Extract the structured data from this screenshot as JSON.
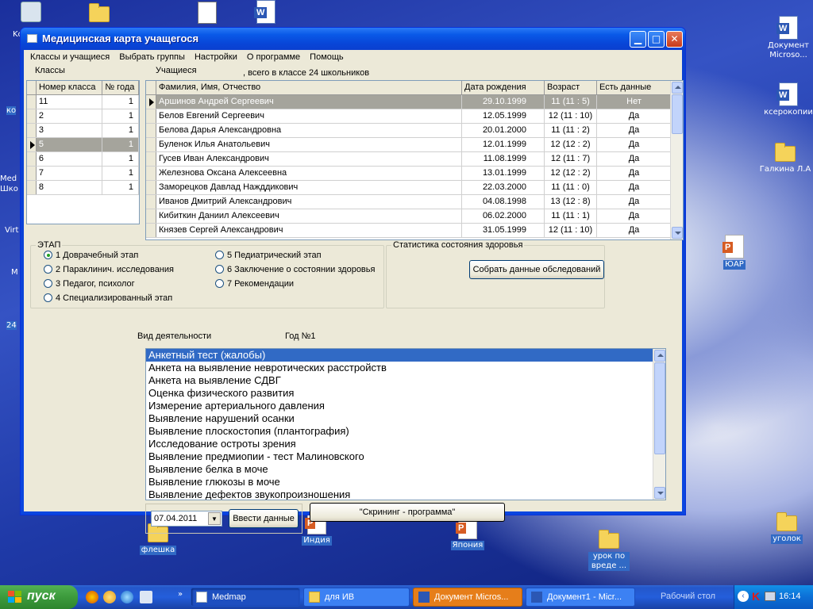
{
  "desktop": {
    "icons": [
      {
        "label": "Документ Microso...",
        "kind": "word"
      },
      {
        "label": "ксерокопии",
        "kind": "word"
      },
      {
        "label": "Галкина Л.А",
        "kind": "folder"
      },
      {
        "label": "ЮАР",
        "kind": "ppt"
      },
      {
        "label": "уголок",
        "kind": "folder"
      },
      {
        "label": "урок по вреде ...",
        "kind": "folder"
      },
      {
        "label": "Япония",
        "kind": "ppt"
      },
      {
        "label": "Индия",
        "kind": "ppt"
      },
      {
        "label": "флешка",
        "kind": "folder"
      }
    ],
    "edge_labels": [
      "Kc",
      "ко",
      "Med",
      "Шко",
      "Virt",
      "M",
      "24"
    ]
  },
  "window": {
    "title": "Медицинская карта учащегося",
    "menu": [
      "Классы и учащиеся",
      "Выбрать группы",
      "Настройки",
      "О программе",
      "Помощь"
    ],
    "classes_label": "Классы",
    "students_label": "Учащиеся",
    "students_count_text": ", всего в классе 24 школьников",
    "classes_table": {
      "headers": [
        "Номер класса",
        "№ года"
      ],
      "rows": [
        [
          "11",
          "1"
        ],
        [
          "2",
          "1"
        ],
        [
          "3",
          "1"
        ],
        [
          "5",
          "1"
        ],
        [
          "6",
          "1"
        ],
        [
          "7",
          "1"
        ],
        [
          "8",
          "1"
        ]
      ],
      "selected_index": 3
    },
    "students_table": {
      "headers": [
        "Фамилия, Имя, Отчество",
        "Дата рождения",
        "Возраст",
        "Есть данные"
      ],
      "rows": [
        [
          "Аршинов Андрей Сергеевич",
          "29.10.1999",
          "11 (11 : 5)",
          "Нет"
        ],
        [
          "Белов Евгений Сергеевич",
          "12.05.1999",
          "12 (11 : 10)",
          "Да"
        ],
        [
          "Белова Дарья Александровна",
          "20.01.2000",
          "11 (11 : 2)",
          "Да"
        ],
        [
          "Буленок Илья  Анатольевич",
          "12.01.1999",
          "12 (12 : 2)",
          "Да"
        ],
        [
          "Гусев Иван Александрович",
          "11.08.1999",
          "12 (11 : 7)",
          "Да"
        ],
        [
          "Железнова Оксана Алексеевна",
          "13.01.1999",
          "12 (12 : 2)",
          "Да"
        ],
        [
          "Заморецков Давлад Нажддикович",
          "22.03.2000",
          "11 (11 : 0)",
          "Да"
        ],
        [
          "Иванов Дмитрий Александрович",
          "04.08.1998",
          "13 (12 : 8)",
          "Да"
        ],
        [
          "Кибиткин Даниил Алексеевич",
          "06.02.2000",
          "11 (11 : 1)",
          "Да"
        ],
        [
          "Князев Сергей Александрович",
          "31.05.1999",
          "12 (11 : 10)",
          "Да"
        ]
      ],
      "selected_index": 0
    },
    "stage_group": {
      "title": "ЭТАП",
      "options": [
        "1 Доврачебный этап",
        "2 Параклинич. исследования",
        "3 Педагог, психолог",
        "4 Специализированный этап",
        "5 Педиатрический этап",
        "6 Заключение о состоянии здоровья",
        "7 Рекомендации"
      ],
      "selected": 0
    },
    "health_group": {
      "title": "Статистика состояния здоровья",
      "collect_button": "Собрать данные обследований"
    },
    "activity_label": "Вид деятельности",
    "year_label": "Год №1",
    "activities": [
      "Анкетный тест (жалобы)",
      "Анкета на выявление невротических расстройств",
      "Анкета на выявление СДВГ",
      "Оценка физического развития",
      "Измерение артериального давления",
      "Выявление нарушений осанки",
      "Выявление плоскостопия (плантография)",
      "Исследование остроты зрения",
      "Выявление предмиопии - тест Малиновского",
      "Выявление белка в моче",
      "Выявление глюкозы в моче",
      "Выявление дефектов звукопроизношения"
    ],
    "activities_selected": 0,
    "date_value": "07.04.2011",
    "enter_button": "Ввести данные",
    "screening_button": "\"Скрининг - программа\""
  },
  "taskbar": {
    "start": "пуск",
    "tasks": [
      {
        "label": "Medmap",
        "active": true
      },
      {
        "label": "для ИВ",
        "active": false
      },
      {
        "label": "Документ Micros...",
        "active": false
      },
      {
        "label": "Документ1 - Micr...",
        "active": false
      }
    ],
    "desktop_label": "Рабочий стол",
    "clock": "16:14"
  },
  "colors": {
    "titlebar": "#0a5ae8",
    "selection": "#316ac5",
    "grid_selected": "#a5a49c",
    "window_bg": "#ece9d8"
  }
}
